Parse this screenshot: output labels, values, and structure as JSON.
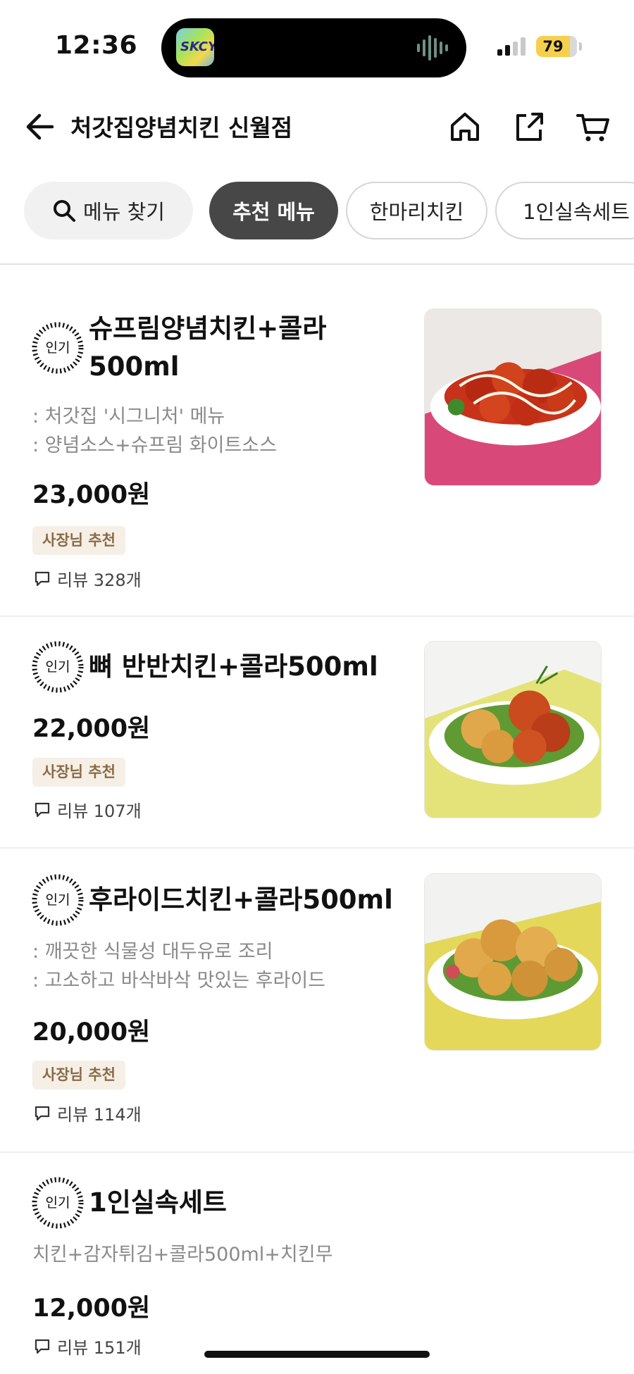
{
  "status_bar": {
    "time": "12:36",
    "island_app_label": "SKCY",
    "battery": "79"
  },
  "header": {
    "title": "처갓집양념치킨 신월점"
  },
  "tabs": {
    "search_label": "메뉴 찾기",
    "items": [
      "추천 메뉴",
      "한마리치킨",
      "1인실속세트"
    ]
  },
  "menu_items": [
    {
      "badge": "인기",
      "name_line1": "슈프림양념치킨+콜라",
      "name_line2": "500ml",
      "desc": [
        ": 처갓집 '시그니처' 메뉴",
        ": 양념소스+슈프림 화이트소스"
      ],
      "price": "23,000원",
      "owner_badge": "사장님 추천",
      "review": "리뷰 328개"
    },
    {
      "badge": "인기",
      "name_line1": "뼈 반반치킨+콜라500ml",
      "price": "22,000원",
      "owner_badge": "사장님 추천",
      "review": "리뷰 107개"
    },
    {
      "badge": "인기",
      "name_line1": "후라이드치킨+콜라500ml",
      "desc": [
        ": 깨끗한 식물성 대두유로 조리",
        ": 고소하고 바삭바삭 맛있는 후라이드"
      ],
      "price": "20,000원",
      "owner_badge": "사장님 추천",
      "review": "리뷰 114개"
    },
    {
      "badge": "인기",
      "name_line1": "1인실속세트",
      "desc": [
        "치킨+감자튀김+콜라500ml+치킨무"
      ],
      "price": "12,000원",
      "review": "리뷰 151개"
    }
  ],
  "colors": {
    "active_tab": "#474747",
    "owner_badge_bg": "#f6efe6",
    "owner_badge_text": "#8a6a47",
    "battery": "#f6d04d"
  },
  "icons": [
    "back-arrow-icon",
    "home-icon",
    "share-icon",
    "cart-icon",
    "search-icon",
    "comment-icon"
  ]
}
